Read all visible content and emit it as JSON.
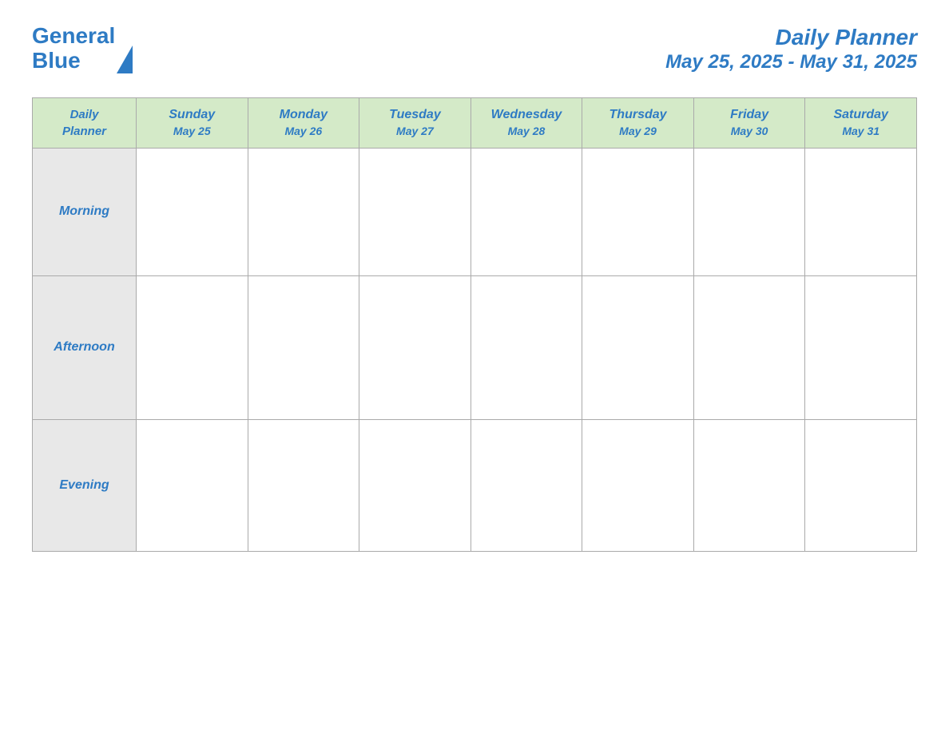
{
  "header": {
    "logo": {
      "text_general": "General",
      "text_blue": "Blue"
    },
    "title": "Daily Planner",
    "date_range": "May 25, 2025 - May 31, 2025"
  },
  "table": {
    "header_label_line1": "Daily",
    "header_label_line2": "Planner",
    "days": [
      {
        "name": "Sunday",
        "date": "May 25"
      },
      {
        "name": "Monday",
        "date": "May 26"
      },
      {
        "name": "Tuesday",
        "date": "May 27"
      },
      {
        "name": "Wednesday",
        "date": "May 28"
      },
      {
        "name": "Thursday",
        "date": "May 29"
      },
      {
        "name": "Friday",
        "date": "May 30"
      },
      {
        "name": "Saturday",
        "date": "May 31"
      }
    ],
    "rows": [
      {
        "label": "Morning"
      },
      {
        "label": "Afternoon"
      },
      {
        "label": "Evening"
      }
    ]
  }
}
